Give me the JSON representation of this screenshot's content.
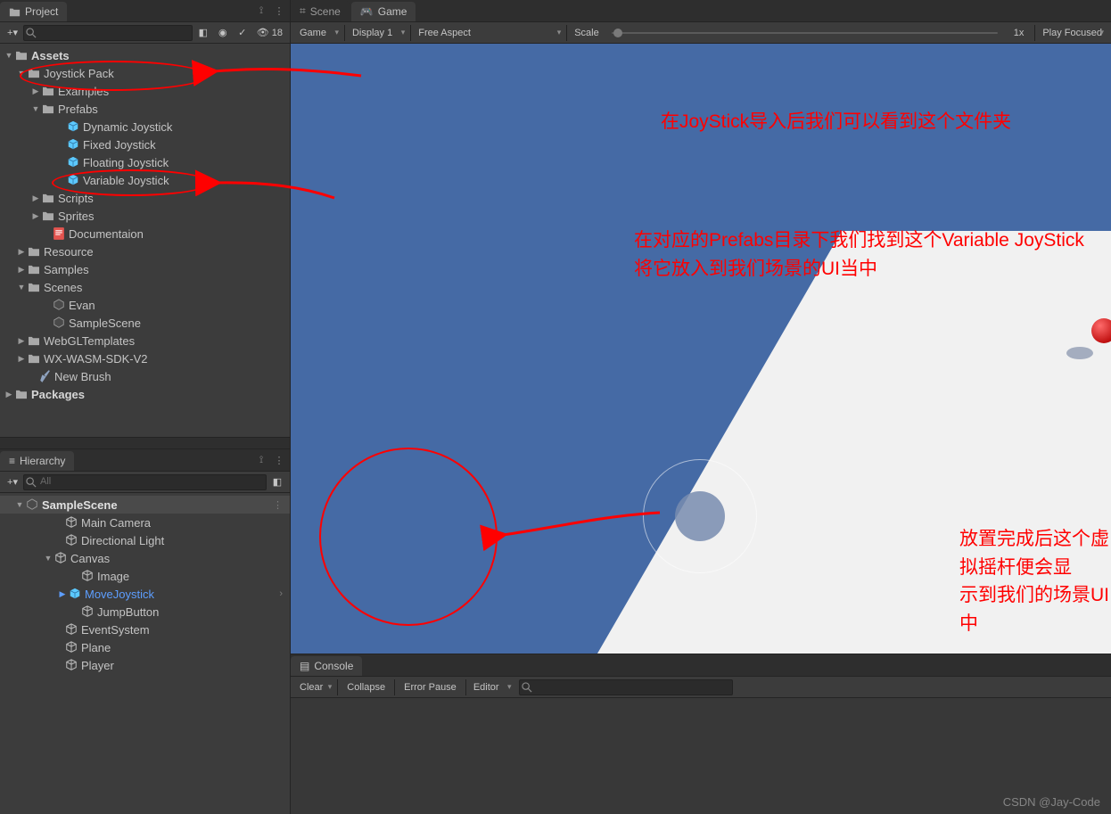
{
  "topbar": {
    "project": "Project",
    "scene": "Scene",
    "game": "Game",
    "console": "Console",
    "hierarchy": "Hierarchy"
  },
  "project_toolbar": {
    "add": "+",
    "search_ph": "",
    "eye_count": "18"
  },
  "game_toolbar": {
    "mode": "Game",
    "display": "Display 1",
    "aspect": "Free Aspect",
    "scale_label": "Scale",
    "scale_value": "1x",
    "play_focused": "Play Focused"
  },
  "hierarchy_toolbar": {
    "add": "+",
    "search_ph": "All"
  },
  "console_toolbar": {
    "clear": "Clear",
    "collapse": "Collapse",
    "error_pause": "Error Pause",
    "editor": "Editor"
  },
  "project_tree": {
    "assets": "Assets",
    "joystick_pack": "Joystick Pack",
    "examples": "Examples",
    "prefabs": "Prefabs",
    "dynamic": "Dynamic Joystick",
    "fixed": "Fixed Joystick",
    "floating": "Floating Joystick",
    "variable": "Variable Joystick",
    "scripts": "Scripts",
    "sprites": "Sprites",
    "documentation": "Documentaion",
    "resource": "Resource",
    "samples": "Samples",
    "scenes": "Scenes",
    "evan": "Evan",
    "samplescene": "SampleScene",
    "webgl": "WebGLTemplates",
    "wasm": "WX-WASM-SDK-V2",
    "newbrush": "New Brush",
    "packages": "Packages"
  },
  "hierarchy_tree": {
    "scene": "SampleScene",
    "main_camera": "Main Camera",
    "dir_light": "Directional Light",
    "canvas": "Canvas",
    "image": "Image",
    "move_joystick": "MoveJoystick",
    "jump_button": "JumpButton",
    "event_system": "EventSystem",
    "plane": "Plane",
    "player": "Player"
  },
  "annotations": {
    "a1": "在JoyStick导入后我们可以看到这个文件夹",
    "a2_l1": "在对应的Prefabs目录下我们找到这个Variable JoyStick",
    "a2_l2": "将它放入到我们场景的UI当中",
    "a3_l1": "放置完成后这个虚拟摇杆便会显",
    "a3_l2": "示到我们的场景UI中"
  },
  "watermark": "CSDN @Jay-Code"
}
